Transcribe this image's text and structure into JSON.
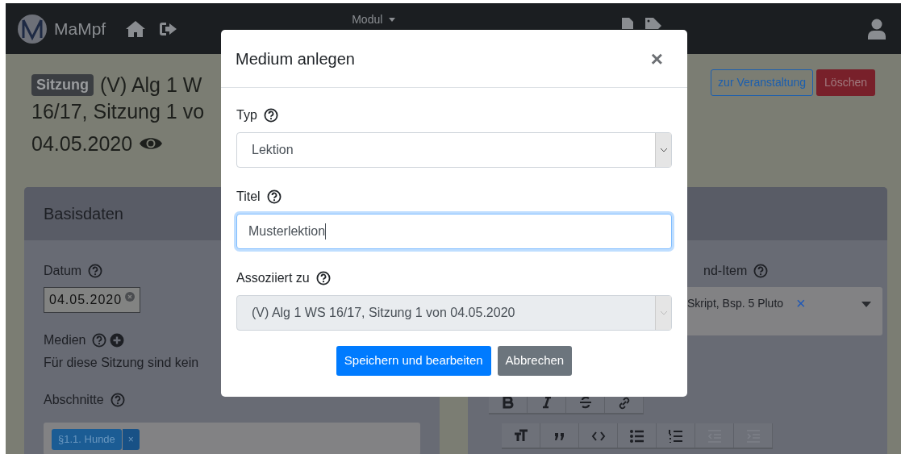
{
  "navbar": {
    "brand": "MaMpf",
    "menu": "Modul"
  },
  "header": {
    "badge": "Sitzung",
    "title_lines": [
      "(V) Alg 1 W",
      "16/17, Sitzung 1 vo"
    ],
    "date": "04.05.2020",
    "buttons": [
      {
        "label": "zur Veranstaltung",
        "kind": "outline"
      },
      {
        "label": "Löschen",
        "kind": "danger"
      }
    ]
  },
  "basisdaten": {
    "title": "Basisdaten",
    "date_label": "Datum",
    "date_value": "04.05.2020",
    "media_label": "Medien",
    "media_note": "Für diese Sitzung sind kein",
    "sections_label": "Abschnitte",
    "tags": [
      {
        "label": "§1.1. Hunde",
        "remove": "×"
      }
    ]
  },
  "right_card": {
    "label": "nd-Item",
    "items": [
      {
        "label": "Skript, Bsp. 5 Pluto",
        "remove": "×"
      }
    ],
    "toolbar": [
      [
        {
          "kind": "bold",
          "disabled": false
        },
        {
          "kind": "italic",
          "disabled": false
        },
        {
          "kind": "strike",
          "disabled": false
        },
        {
          "kind": "link",
          "disabled": false
        }
      ],
      [
        {
          "kind": "heading",
          "disabled": false
        },
        {
          "kind": "quote",
          "disabled": false
        },
        {
          "kind": "code",
          "disabled": false
        },
        {
          "kind": "bullets",
          "disabled": false
        },
        {
          "kind": "numbers",
          "disabled": false
        },
        {
          "kind": "outdent",
          "disabled": true
        },
        {
          "kind": "indent",
          "disabled": true
        }
      ]
    ]
  },
  "modal": {
    "title": "Medium anlegen",
    "close": "×",
    "fields": [
      {
        "label": "Typ",
        "kind": "select",
        "value": "Lektion",
        "disabled": false,
        "focused": false
      },
      {
        "label": "Titel",
        "kind": "text",
        "value": "Musterlektion",
        "disabled": false,
        "focused": true
      },
      {
        "label": "Assoziiert zu",
        "kind": "select",
        "value": "(V) Alg 1 WS 16/17, Sitzung 1 von 04.05.2020",
        "disabled": true,
        "focused": false
      }
    ],
    "buttons": [
      {
        "label": "Speichern und bearbeiten",
        "kind": "primary"
      },
      {
        "label": "Abbrechen",
        "kind": "secondary"
      }
    ]
  }
}
